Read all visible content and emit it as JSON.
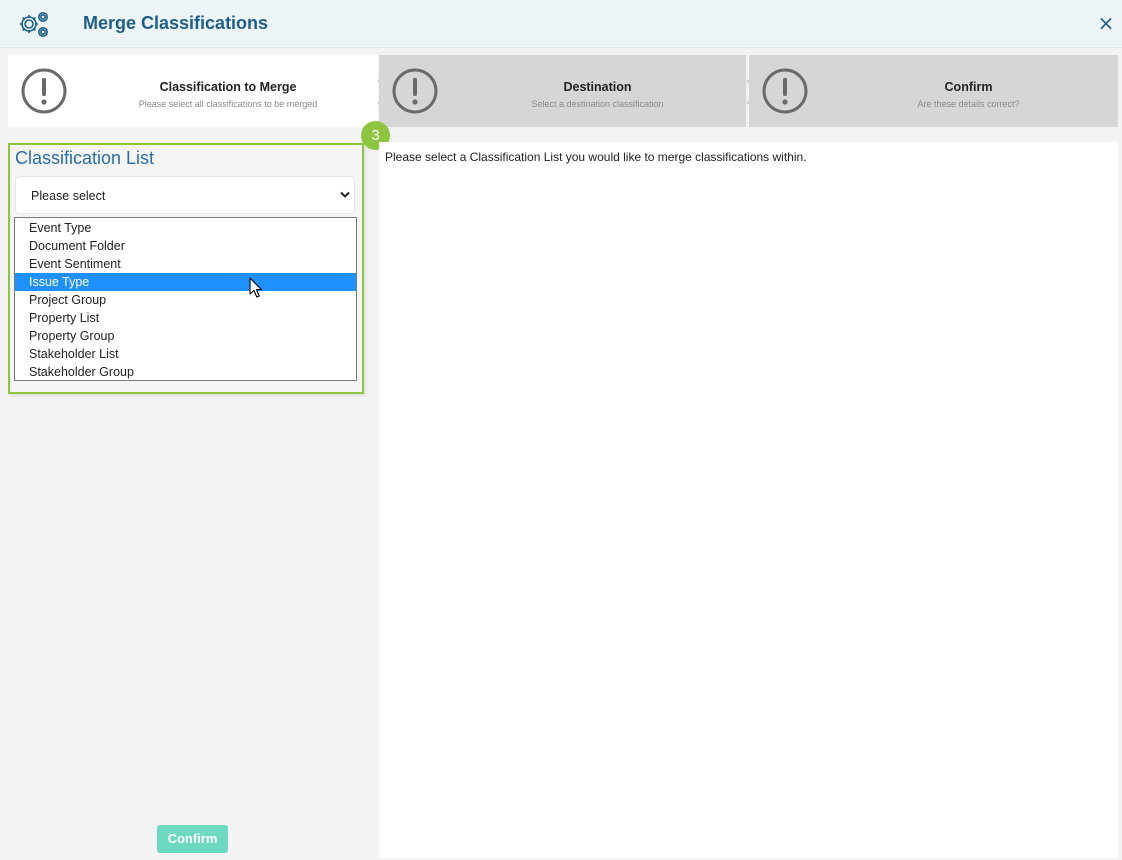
{
  "window": {
    "title": "Merge Classifications",
    "close_label": "×",
    "icon": "gears-icon"
  },
  "steps": [
    {
      "title": "Classification to Merge",
      "subtitle": "Please select all classifications to be merged",
      "active": true
    },
    {
      "title": "Destination",
      "subtitle": "Select a destination classification",
      "active": false
    },
    {
      "title": "Confirm",
      "subtitle": "Are these details correct?",
      "active": false
    }
  ],
  "classification_list": {
    "heading": "Classification List",
    "select_value": "Please select",
    "options": [
      "Event Type",
      "Document Folder",
      "Event Sentiment",
      "Issue Type",
      "Project Group",
      "Property List",
      "Property Group",
      "Stakeholder List",
      "Stakeholder Group"
    ],
    "highlighted_option": "Issue Type"
  },
  "tutorial_badge": "3",
  "confirm_label": "Confirm",
  "right_panel": {
    "message": "Please select a Classification List you would like to merge classifications within."
  },
  "colors": {
    "accent": "#1d5e8a",
    "highlight_border": "#8cc63f",
    "selected_option": "#1e90ff",
    "confirm_button": "#6dd9c0"
  }
}
